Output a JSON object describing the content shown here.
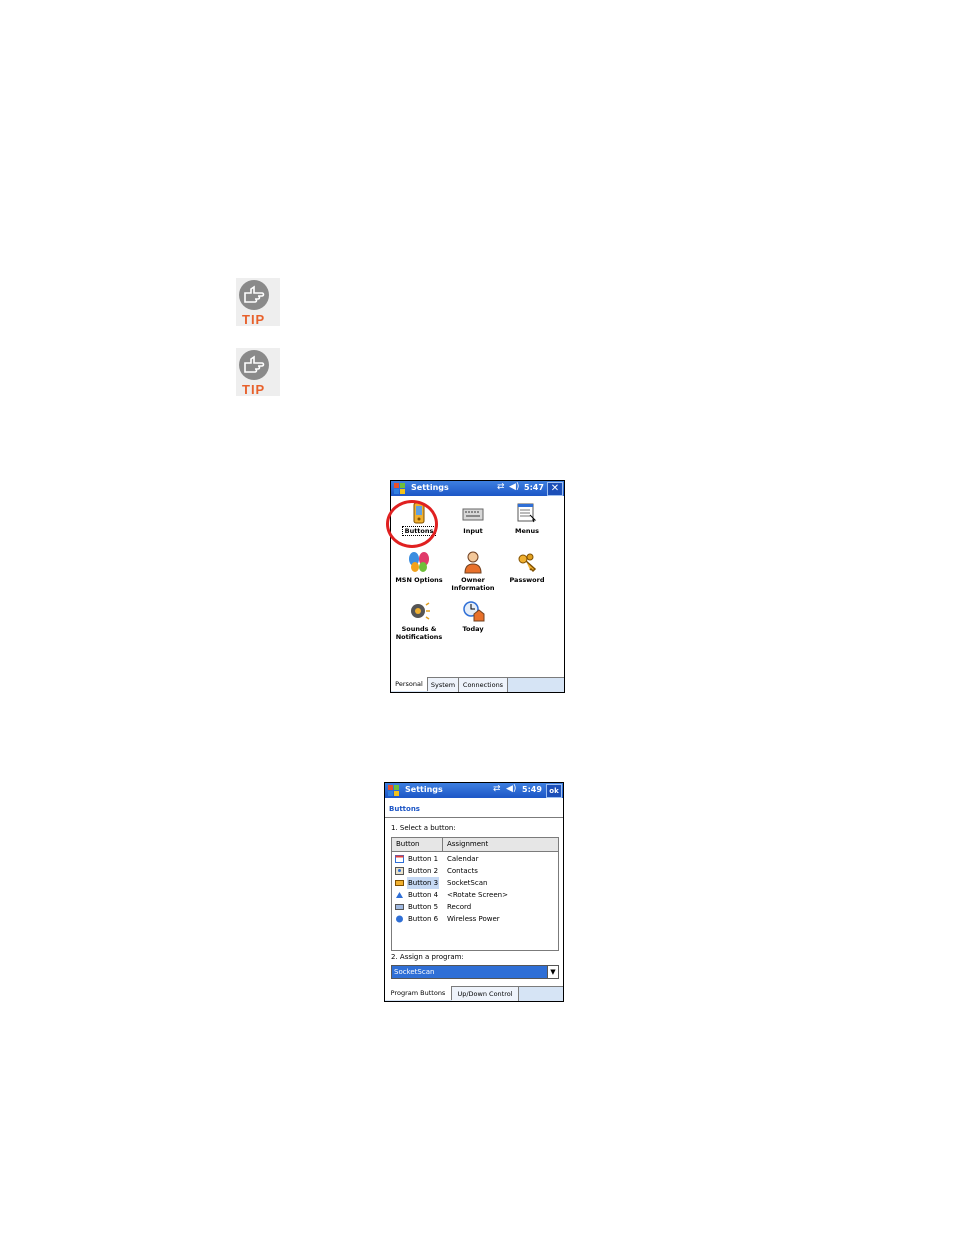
{
  "tips": [
    {
      "label": "TIP"
    },
    {
      "label": "TIP"
    }
  ],
  "screen1": {
    "title": "Settings",
    "clock": "5:47",
    "close_label": "✕",
    "icons": [
      {
        "label": "Buttons"
      },
      {
        "label": "Input"
      },
      {
        "label": "Menus"
      },
      {
        "label": "MSN Options"
      },
      {
        "label": "Owner Information"
      },
      {
        "label": "Password"
      },
      {
        "label": "Sounds & Notifications"
      },
      {
        "label": "Today"
      }
    ],
    "tabs": [
      {
        "label": "Personal"
      },
      {
        "label": "System"
      },
      {
        "label": "Connections"
      }
    ]
  },
  "screen2": {
    "title": "Settings",
    "clock": "5:49",
    "ok_label": "ok",
    "subheader": "Buttons",
    "step1": "1. Select a button:",
    "columns": {
      "button": "Button",
      "assignment": "Assignment"
    },
    "rows": [
      {
        "button": "Button 1",
        "assignment": "Calendar"
      },
      {
        "button": "Button 2",
        "assignment": "Contacts"
      },
      {
        "button": "Button 3",
        "assignment": "SocketScan"
      },
      {
        "button": "Button 4",
        "assignment": "<Rotate Screen>"
      },
      {
        "button": "Button 5",
        "assignment": "Record"
      },
      {
        "button": "Button 6",
        "assignment": "Wireless Power"
      }
    ],
    "step2": "2. Assign a program:",
    "program_value": "SocketScan",
    "tabs": [
      {
        "label": "Program Buttons"
      },
      {
        "label": "Up/Down Control"
      }
    ]
  }
}
